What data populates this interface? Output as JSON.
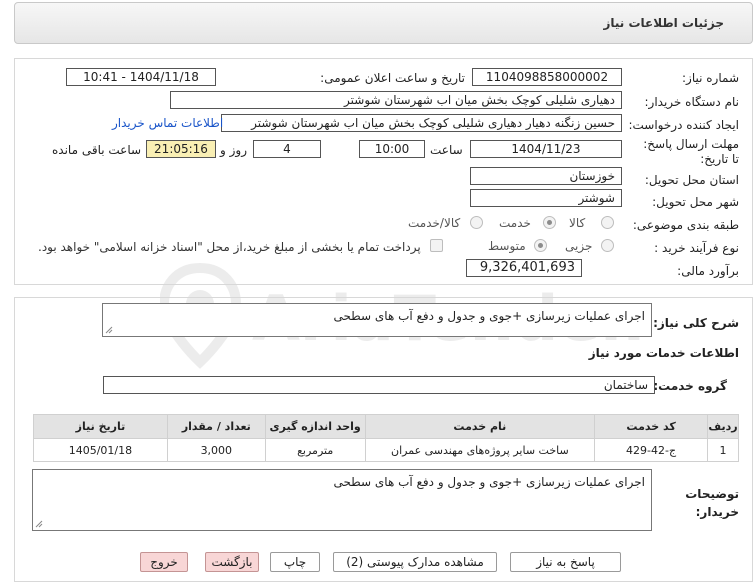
{
  "header": {
    "title": "جزئیات اطلاعات نیاز"
  },
  "fields": {
    "need_number_label": "شماره نیاز:",
    "need_number": "1104098858000002",
    "announce_label": "تاریخ و ساعت اعلان عمومی:",
    "announce_value": "1404/11/18 - 10:41",
    "buyer_label": "نام دستگاه خریدار:",
    "buyer_value": "دهیاری شلیلی کوچک بخش میان اب  شهرستان شوشتر",
    "creator_label": "ایجاد کننده درخواست:",
    "creator_value": "حسین زنگنه دهیار دهیاری شلیلی کوچک بخش میان اب  شهرستان شوشتر",
    "contact_link": "اطلاعات تماس خریدار",
    "deadline_label": "مهلت ارسال پاسخ: تا تاریخ:",
    "deadline_date": "1404/11/23",
    "time_label": "ساعت",
    "deadline_time": "10:00",
    "days_value": "4",
    "days_label": "روز و",
    "remaining_time": "21:05:16",
    "remaining_label": "ساعت باقی مانده",
    "province_label": "استان محل تحویل:",
    "province_value": "خوزستان",
    "city_label": "شهر محل تحویل:",
    "city_value": "شوشتر",
    "category_label": "طبقه بندی موضوعی:",
    "category_options": [
      "کالا",
      "خدمت",
      "کالا/خدمت"
    ],
    "category_selected": "خدمت",
    "process_label": "نوع فرآیند خرید :",
    "process_options": [
      "جزیی",
      "متوسط"
    ],
    "process_selected": "متوسط",
    "payment_note": "پرداخت تمام یا بخشی از مبلغ خرید،از محل \"اسناد خزانه اسلامی\" خواهد بود.",
    "estimate_label": "برآورد مالی:",
    "estimate_value": "9,326,401,693"
  },
  "need_desc": {
    "label": "شرح کلی نیاز:",
    "value": "اجرای عملیات زیرسازی +جوی و جدول و دفع آب های سطحی"
  },
  "services": {
    "title": "اطلاعات خدمات مورد نیاز",
    "group_label": "گروه خدمت:",
    "group_value": "ساختمان",
    "columns": [
      "ردیف",
      "کد خدمت",
      "نام خدمت",
      "واحد اندازه گیری",
      "تعداد / مقدار",
      "تاریخ نیاز"
    ],
    "rows": [
      [
        "1",
        "ج-42-429",
        "ساخت سایر پروژه‌های مهندسی عمران",
        "مترمربع",
        "3,000",
        "1405/01/18"
      ]
    ]
  },
  "buyer_notes": {
    "label": "توضیحات خریدار:",
    "value": "اجرای عملیات زیرسازی +جوی و جدول و دفع آب های سطحی"
  },
  "buttons": {
    "reply": "پاسخ به نیاز",
    "attachments": "مشاهده مدارک پیوستی (2)",
    "print": "چاپ",
    "back": "بازگشت",
    "exit": "خروج"
  },
  "watermark": "AriaTender.neT"
}
